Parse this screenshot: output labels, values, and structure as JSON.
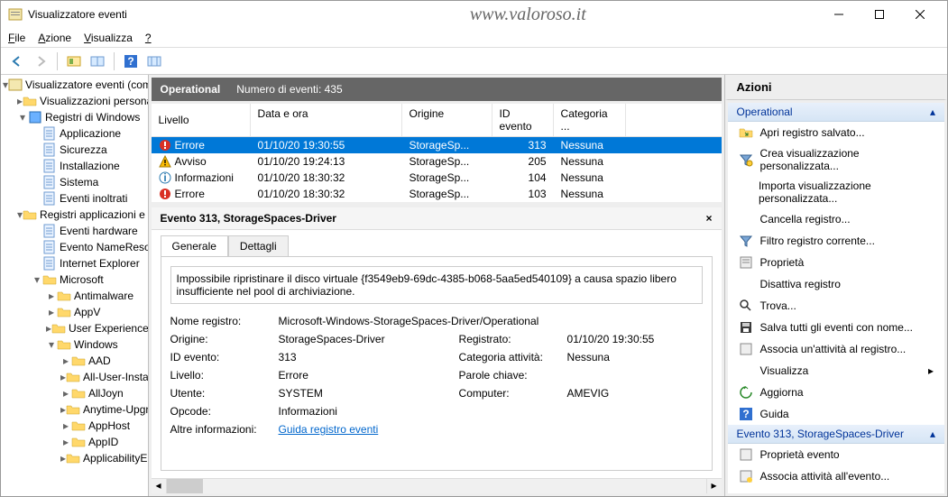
{
  "window": {
    "title": "Visualizzatore eventi",
    "watermark": "www.valoroso.it"
  },
  "menu": {
    "file": "File",
    "action": "Azione",
    "view": "Visualizza",
    "help": "?"
  },
  "tree": {
    "root": "Visualizzatore eventi (compu",
    "custom": "Visualizzazioni personalizz",
    "winlogs": "Registri di Windows",
    "winlogs_children": [
      "Applicazione",
      "Sicurezza",
      "Installazione",
      "Sistema",
      "Eventi inoltrati"
    ],
    "applogs": "Registri applicazioni e ser",
    "l1": [
      "Eventi hardware",
      "Evento NameResoluti",
      "Internet Explorer"
    ],
    "ms": "Microsoft",
    "ms_children": [
      "Antimalware",
      "AppV",
      "User Experience Vi"
    ],
    "win": "Windows",
    "win_children": [
      "AAD",
      "All-User-Instal",
      "AllJoyn",
      "Anytime-Upgr",
      "AppHost",
      "AppID",
      "ApplicabilityEr"
    ]
  },
  "header": {
    "section": "Operational",
    "count_label": "Numero di eventi:",
    "count": "435"
  },
  "cols": {
    "level": "Livello",
    "date": "Data e ora",
    "origin": "Origine",
    "id": "ID evento",
    "cat": "Categoria ..."
  },
  "rows": [
    {
      "level": "Errore",
      "icon": "err",
      "date": "01/10/20 19:30:55",
      "origin": "StorageSp...",
      "id": "313",
      "cat": "Nessuna",
      "sel": true
    },
    {
      "level": "Avviso",
      "icon": "warn",
      "date": "01/10/20 19:24:13",
      "origin": "StorageSp...",
      "id": "205",
      "cat": "Nessuna"
    },
    {
      "level": "Informazioni",
      "icon": "info",
      "date": "01/10/20 18:30:32",
      "origin": "StorageSp...",
      "id": "104",
      "cat": "Nessuna"
    },
    {
      "level": "Errore",
      "icon": "err",
      "date": "01/10/20 18:30:32",
      "origin": "StorageSp...",
      "id": "103",
      "cat": "Nessuna"
    }
  ],
  "detail": {
    "title": "Evento 313, StorageSpaces-Driver",
    "tab_general": "Generale",
    "tab_details": "Dettagli",
    "message": "Impossibile ripristinare il disco virtuale {f3549eb9-69dc-4385-b068-5aa5ed540109} a causa spazio libero insufficiente nel pool di archiviazione.",
    "props": {
      "logname_l": "Nome registro:",
      "logname_v": "Microsoft-Windows-StorageSpaces-Driver/Operational",
      "source_l": "Origine:",
      "source_v": "StorageSpaces-Driver",
      "logged_l": "Registrato:",
      "logged_v": "01/10/20 19:30:55",
      "id_l": "ID evento:",
      "id_v": "313",
      "cat_l": "Categoria attività:",
      "cat_v": "Nessuna",
      "level_l": "Livello:",
      "level_v": "Errore",
      "kw_l": "Parole chiave:",
      "kw_v": "",
      "user_l": "Utente:",
      "user_v": "SYSTEM",
      "comp_l": "Computer:",
      "comp_v": "AMEVIG",
      "op_l": "Opcode:",
      "op_v": "Informazioni",
      "more_l": "Altre informazioni:",
      "more_v": "Guida registro eventi"
    }
  },
  "actions": {
    "title": "Azioni",
    "section1": "Operational",
    "items1": [
      "Apri registro salvato...",
      "Crea visualizzazione personalizzata...",
      "Importa visualizzazione personalizzata...",
      "Cancella registro...",
      "Filtro registro corrente...",
      "Proprietà",
      "Disattiva registro",
      "Trova...",
      "Salva tutti gli eventi con nome...",
      "Associa un'attività al registro...",
      "Visualizza",
      "Aggiorna",
      "Guida"
    ],
    "section2": "Evento 313, StorageSpaces-Driver",
    "items2": [
      "Proprietà evento",
      "Associa attività all'evento..."
    ]
  }
}
